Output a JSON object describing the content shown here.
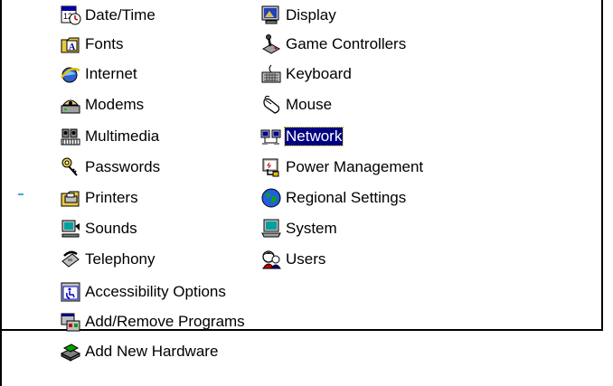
{
  "control_panel": {
    "items": [
      {
        "label": "Date/Time",
        "icon": "calendar-clock-icon"
      },
      {
        "label": "Display",
        "icon": "monitor-display-icon"
      },
      {
        "label": "Fonts",
        "icon": "font-folder-icon"
      },
      {
        "label": "Game Controllers",
        "icon": "joystick-icon"
      },
      {
        "label": "Internet",
        "icon": "internet-globe-icon"
      },
      {
        "label": "Keyboard",
        "icon": "keyboard-icon"
      },
      {
        "label": "Modems",
        "icon": "modem-phone-icon"
      },
      {
        "label": "Mouse",
        "icon": "mouse-icon"
      },
      {
        "label": "Multimedia",
        "icon": "multimedia-icon"
      },
      {
        "label": "Network",
        "icon": "network-computers-icon"
      },
      {
        "label": "Passwords",
        "icon": "keys-icon"
      },
      {
        "label": "Power Management",
        "icon": "power-plug-icon"
      },
      {
        "label": "Printers",
        "icon": "printer-folder-icon"
      },
      {
        "label": "Regional Settings",
        "icon": "globe-icon"
      },
      {
        "label": "Sounds",
        "icon": "speaker-icon"
      },
      {
        "label": "System",
        "icon": "computer-icon"
      },
      {
        "label": "Telephony",
        "icon": "telephone-icon"
      },
      {
        "label": "Users",
        "icon": "users-icon"
      },
      {
        "label": "Accessibility Options",
        "icon": "accessibility-icon"
      },
      {
        "label": "Add/Remove Programs",
        "icon": "add-remove-programs-icon"
      },
      {
        "label": "Add New Hardware",
        "icon": "add-hardware-icon"
      }
    ],
    "selected_item": "Network"
  },
  "colors": {
    "selection_background": "#000080",
    "selection_text": "#ffffff",
    "background": "#ffffff"
  }
}
